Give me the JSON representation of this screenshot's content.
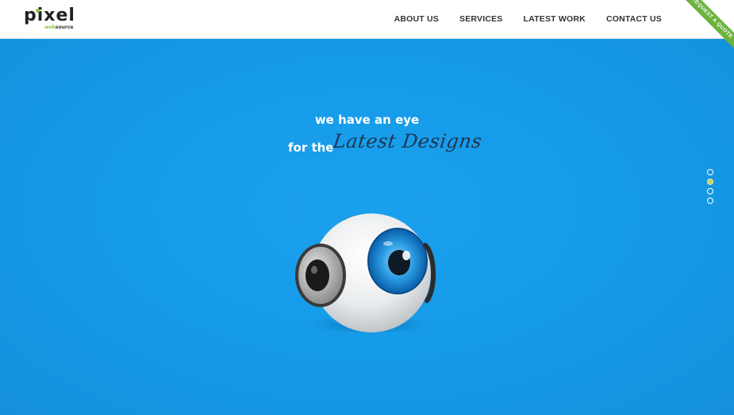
{
  "brand": {
    "name": "pixel",
    "tagline_accent": "web",
    "tagline_rest": "source",
    "accent_color": "#8cc63f"
  },
  "nav": {
    "items": [
      {
        "label": "ABOUT US"
      },
      {
        "label": "SERVICES"
      },
      {
        "label": "LATEST WORK"
      },
      {
        "label": "CONTACT US"
      }
    ]
  },
  "ribbon": {
    "label": "REQUEST A QUOTE",
    "color": "#6cb33e"
  },
  "hero": {
    "line1": "we have an eye",
    "line2_prefix": "for the",
    "line2_script": "Latest Designs",
    "background_color": "#159be8",
    "mascot_icon": "eyeball-with-headphones-icon"
  },
  "slider": {
    "count": 4,
    "active_index": 1
  }
}
